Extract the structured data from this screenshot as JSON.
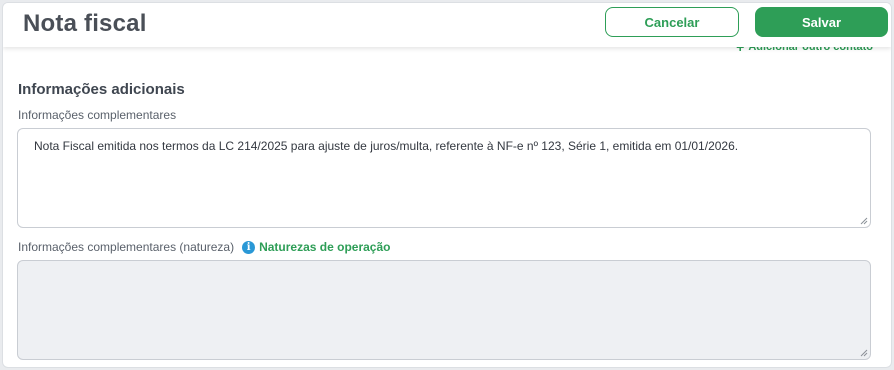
{
  "header": {
    "title": "Nota fiscal",
    "cancel_label": "Cancelar",
    "save_label": "Salvar"
  },
  "add_contact_label": "Adicionar outro contato",
  "section": {
    "title": "Informações adicionais",
    "complementary_label": "Informações complementares",
    "complementary_value": "Nota Fiscal emitida nos termos da LC 214/2025 para ajuste de juros/multa, referente à NF-e nº 123, Série 1, emitida em 01/01/2026.",
    "nature_label": "Informações complementares (natureza)",
    "nature_link_label": "Naturezas de operação",
    "nature_value": ""
  },
  "colors": {
    "accent": "#2e9e57",
    "info": "#2a98d6",
    "title_text": "#4a4f57"
  },
  "icons": {
    "plus": "plus-icon",
    "info": "info-icon",
    "resize": "resize-grip-icon"
  }
}
